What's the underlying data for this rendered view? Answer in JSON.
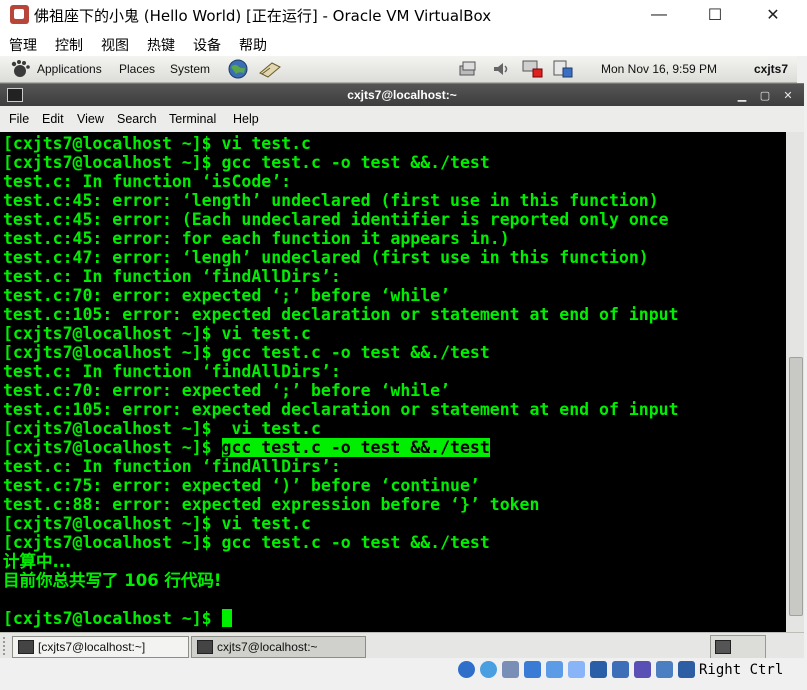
{
  "host_window": {
    "title": "佛祖座下的小鬼 (Hello World) [正在运行] - Oracle VM VirtualBox",
    "controls": {
      "minimize": "—",
      "maximize": "☐",
      "close": "✕"
    },
    "menu": [
      "管理",
      "控制",
      "视图",
      "热键",
      "设备",
      "帮助"
    ]
  },
  "guest_panel": {
    "menu": [
      "Applications",
      "Places",
      "System"
    ],
    "clock": "Mon Nov 16,  9:59 PM",
    "user": "cxjts7"
  },
  "terminal": {
    "title": "cxjts7@localhost:~",
    "menu": [
      "File",
      "Edit",
      "View",
      "Search",
      "Terminal",
      "Help"
    ],
    "lines": [
      "[cxjts7@localhost ~]$ vi test.c",
      "[cxjts7@localhost ~]$ gcc test.c -o test &&./test",
      "test.c: In function ‘isCode’:",
      "test.c:45: error: ‘length’ undeclared (first use in this function)",
      "test.c:45: error: (Each undeclared identifier is reported only once",
      "test.c:45: error: for each function it appears in.)",
      "test.c:47: error: ‘lengh’ undeclared (first use in this function)",
      "test.c: In function ‘findAllDirs’:",
      "test.c:70: error: expected ‘;’ before ‘while’",
      "test.c:105: error: expected declaration or statement at end of input",
      "[cxjts7@localhost ~]$ vi test.c",
      "[cxjts7@localhost ~]$ gcc test.c -o test &&./test",
      "test.c: In function ‘findAllDirs’:",
      "test.c:70: error: expected ‘;’ before ‘while’",
      "test.c:105: error: expected declaration or statement at end of input",
      "[cxjts7@localhost ~]$  vi test.c",
      {
        "prompt": "[cxjts7@localhost ~]$ ",
        "highlighted": "gcc test.c -o test &&./test"
      },
      "test.c: In function ‘findAllDirs’:",
      "test.c:75: error: expected ‘)’ before ‘continue’",
      "test.c:88: error: expected expression before ‘}’ token",
      "[cxjts7@localhost ~]$ vi test.c",
      "[cxjts7@localhost ~]$ gcc test.c -o test &&./test",
      "计算中...",
      "目前你总共写了 106 行代码!",
      "",
      "[cxjts7@localhost ~]$ "
    ]
  },
  "taskbar": {
    "tasks": [
      "[cxjts7@localhost:~]",
      "cxjts7@localhost:~"
    ]
  },
  "vbox_status": {
    "host_key": "Right Ctrl"
  },
  "colors": {
    "terminal_fg": "#00ee00",
    "terminal_bg": "#000000"
  }
}
